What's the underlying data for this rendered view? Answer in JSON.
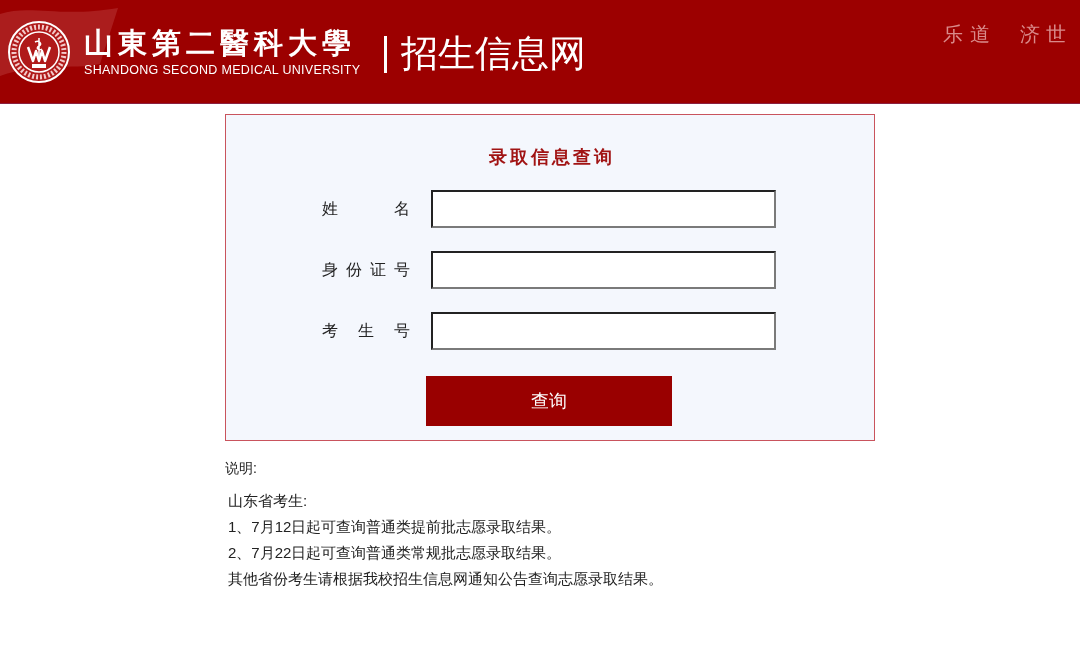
{
  "header": {
    "school_name": "山東第二醫科大學",
    "school_name_en": "SHANDONG SECOND MEDICAL UNIVERSITY",
    "site_title": "招生信息网",
    "motto": [
      "乐 道",
      "济 世"
    ]
  },
  "form": {
    "title": "录取信息查询",
    "fields": [
      {
        "label": "姓 名"
      },
      {
        "label": "身 份 证 号"
      },
      {
        "label": "考 生 号"
      }
    ],
    "submit": "查询"
  },
  "notes": {
    "heading": "说明:",
    "lines": [
      "山东省考生:",
      "1、7月12日起可查询普通类提前批志愿录取结果。",
      "2、7月22日起可查询普通类常规批志愿录取结果。",
      "其他省份考生请根据我校招生信息网通知公告查询志愿录取结果。"
    ]
  }
}
